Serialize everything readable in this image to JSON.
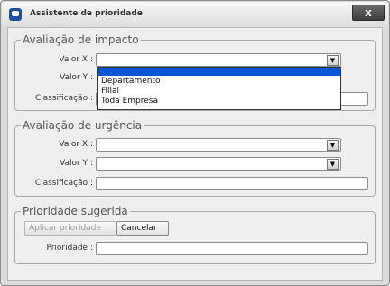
{
  "dialog": {
    "title": "Assistente de prioridade",
    "close_glyph": "x"
  },
  "impact": {
    "legend": "Avaliação de impacto",
    "valor_x_label": "Valor X :",
    "valor_y_label": "Valor Y :",
    "classificacao_label": "Classificação :",
    "valor_x_value": "",
    "classificacao_value": "",
    "dropdown_options": [
      "",
      "Departamento",
      "Filial",
      "Toda Empresa"
    ]
  },
  "urgency": {
    "legend": "Avaliação de urgência",
    "valor_x_label": "Valor X :",
    "valor_y_label": "Valor Y :",
    "classificacao_label": "Classificação :",
    "valor_x_value": "",
    "valor_y_value": "",
    "classificacao_value": ""
  },
  "suggested": {
    "legend": "Prioridade sugerida",
    "apply_label": "Aplicar prioridade",
    "cancel_label": "Cancelar",
    "priority_label": "Prioridade :",
    "priority_value": ""
  },
  "colors": {
    "selection_highlight": "#0a57d6",
    "title_icon": "#1f4f9c"
  }
}
